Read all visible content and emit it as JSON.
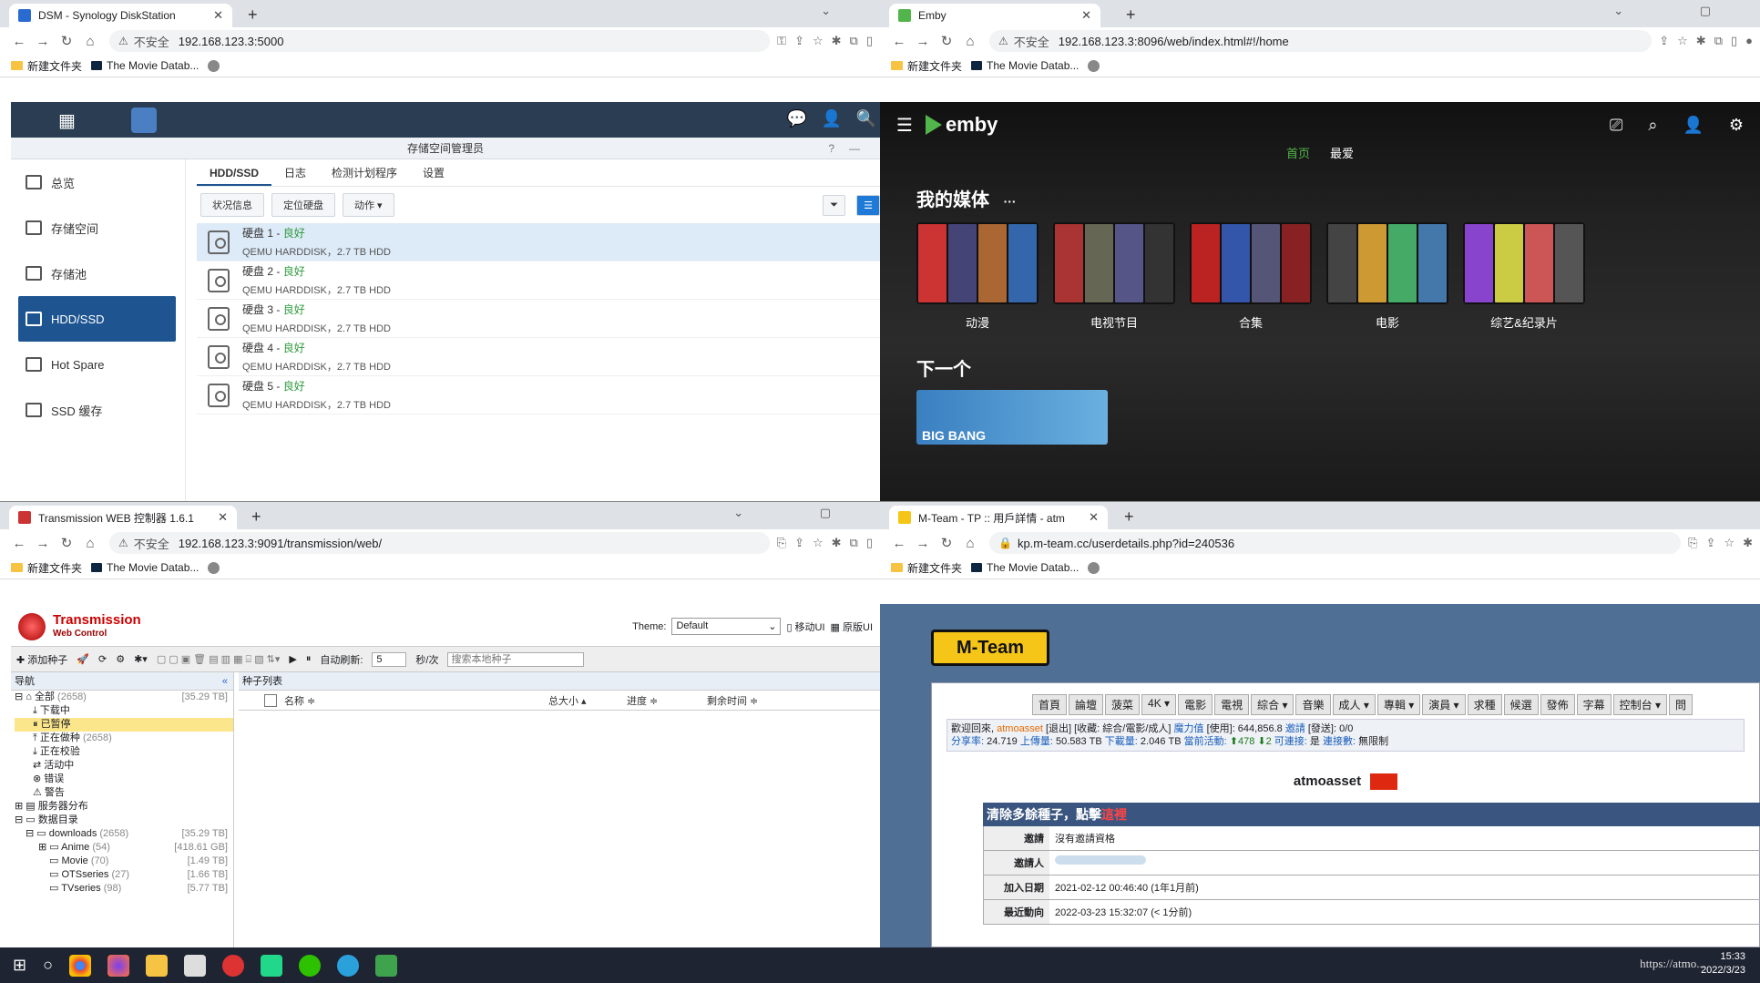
{
  "dsm": {
    "tab_title": "DSM - Synology DiskStation",
    "not_secure": "不安全",
    "url": "192.168.123.3:5000",
    "bookmarks": [
      "新建文件夹",
      "The Movie Datab..."
    ],
    "app_title": "存储空间管理员",
    "sidebar": [
      "总览",
      "存储空间",
      "存储池",
      "HDD/SSD",
      "Hot Spare",
      "SSD 缓存"
    ],
    "tabs": [
      "HDD/SSD",
      "日志",
      "检测计划程序",
      "设置"
    ],
    "buttons": [
      "状况信息",
      "定位硬盘",
      "动作 ▾"
    ],
    "disks": [
      {
        "name": "硬盘 1",
        "status": "良好",
        "detail": "QEMU HARDDISK，2.7 TB HDD"
      },
      {
        "name": "硬盘 2",
        "status": "良好",
        "detail": "QEMU HARDDISK，2.7 TB HDD"
      },
      {
        "name": "硬盘 3",
        "status": "良好",
        "detail": "QEMU HARDDISK，2.7 TB HDD"
      },
      {
        "name": "硬盘 4",
        "status": "良好",
        "detail": "QEMU HARDDISK，2.7 TB HDD"
      },
      {
        "name": "硬盘 5",
        "status": "良好",
        "detail": "QEMU HARDDISK，2.7 TB HDD"
      }
    ]
  },
  "emby": {
    "tab_title": "Emby",
    "not_secure": "不安全",
    "url": "192.168.123.3:8096/web/index.html#!/home",
    "logo": "emby",
    "nav": [
      "首页",
      "最爱"
    ],
    "section_media": "我的媒体",
    "more": "···",
    "libraries": [
      "动漫",
      "电视节目",
      "合集",
      "电影",
      "综艺&纪录片"
    ],
    "section_next": "下一个",
    "next_title": "BIG BANG"
  },
  "transmission": {
    "tab_title": "Transmission WEB 控制器 1.6.1",
    "not_secure": "不安全",
    "url": "192.168.123.3:9091/transmission/web/",
    "title": "Transmission",
    "subtitle": "Web Control",
    "theme_label": "Theme:",
    "theme_value": "Default",
    "mobile_ui": "移动UI",
    "orig_ui": "原版UI",
    "add_torrent": "添加种子",
    "auto_refresh": "自动刷新:",
    "refresh_value": "5",
    "refresh_unit": "秒/次",
    "search_placeholder": "搜索本地种子",
    "nav_header": "导航",
    "list_header": "种子列表",
    "columns": [
      "名称 ≑",
      "总大小 ▴",
      "进度 ≑",
      "剩余时间 ≑"
    ],
    "tree": [
      {
        "label": "全部",
        "count": "(2658)",
        "size": "[35.29 TB]"
      },
      {
        "label": "下载中",
        "count": "",
        "size": ""
      },
      {
        "label": "已暂停",
        "count": "",
        "size": ""
      },
      {
        "label": "正在做种",
        "count": "(2658)",
        "size": ""
      },
      {
        "label": "正在校验",
        "count": "",
        "size": ""
      },
      {
        "label": "活动中",
        "count": "",
        "size": ""
      },
      {
        "label": "错误",
        "count": "",
        "size": ""
      },
      {
        "label": "警告",
        "count": "",
        "size": ""
      },
      {
        "label": "服务器分布",
        "count": "",
        "size": ""
      },
      {
        "label": "数据目录",
        "count": "",
        "size": ""
      },
      {
        "label": "downloads",
        "count": "(2658)",
        "size": "[35.29 TB]"
      },
      {
        "label": "Anime",
        "count": "(54)",
        "size": "[418.61 GB]"
      },
      {
        "label": "Movie",
        "count": "(70)",
        "size": "[1.49 TB]"
      },
      {
        "label": "OTSseries",
        "count": "(27)",
        "size": "[1.66 TB]"
      },
      {
        "label": "TVseries",
        "count": "(98)",
        "size": "[5.77 TB]"
      }
    ]
  },
  "mteam": {
    "tab_title": "M-Team - TP :: 用戶詳情 - atm",
    "url": "kp.m-team.cc/userdetails.php?id=240536",
    "logo": "M-Team",
    "menu": [
      "首頁",
      "論壇",
      "菠菜",
      "4K ▾",
      "電影",
      "電視",
      "綜合 ▾",
      "音樂",
      "成人 ▾",
      "專輯 ▾",
      "演員 ▾",
      "求種",
      "候選",
      "發佈",
      "字幕",
      "控制台 ▾",
      "問"
    ],
    "welcome": "歡迎回來,",
    "user_link": "atmoasset",
    "info_line1_rest": "[退出] [收藏: 綜合/電影/成人]",
    "magic_label": "魔力值",
    "magic_value": "[使用]: 644,856.8",
    "invite_label": "邀請",
    "invite_value": "[發送]: 0/0",
    "ratio_label": "分享率:",
    "ratio_value": "24.719",
    "upload_label": "上傳量:",
    "upload_value": "50.583 TB",
    "download_label": "下載量:",
    "download_value": "2.046 TB",
    "active_label": "當前活動:",
    "active_value": "⬆478 ⬇2",
    "connectable_label": "可連接:",
    "connectable_value": "是",
    "conn_limit_label": "連接數:",
    "conn_limit_value": "無限制",
    "username": "atmoasset",
    "banner": "清除多餘種子，點擊",
    "banner_link": "這裡",
    "rows": [
      {
        "k": "邀請",
        "v": "沒有邀請資格"
      },
      {
        "k": "邀請人",
        "v": ""
      },
      {
        "k": "加入日期",
        "v": "2021-02-12 00:46:40 (1年1月前)"
      },
      {
        "k": "最近動向",
        "v": "2022-03-23 15:32:07 (< 1分前)"
      }
    ]
  },
  "taskbar": {
    "time": "15:33",
    "date": "2022/3/23",
    "watermark": "https://atmo..."
  },
  "colors": {
    "dsm_blue": "#1e5591",
    "emby_green": "#52b54b",
    "transmission_red": "#cc0000",
    "mteam_blue": "#4f6f95"
  }
}
